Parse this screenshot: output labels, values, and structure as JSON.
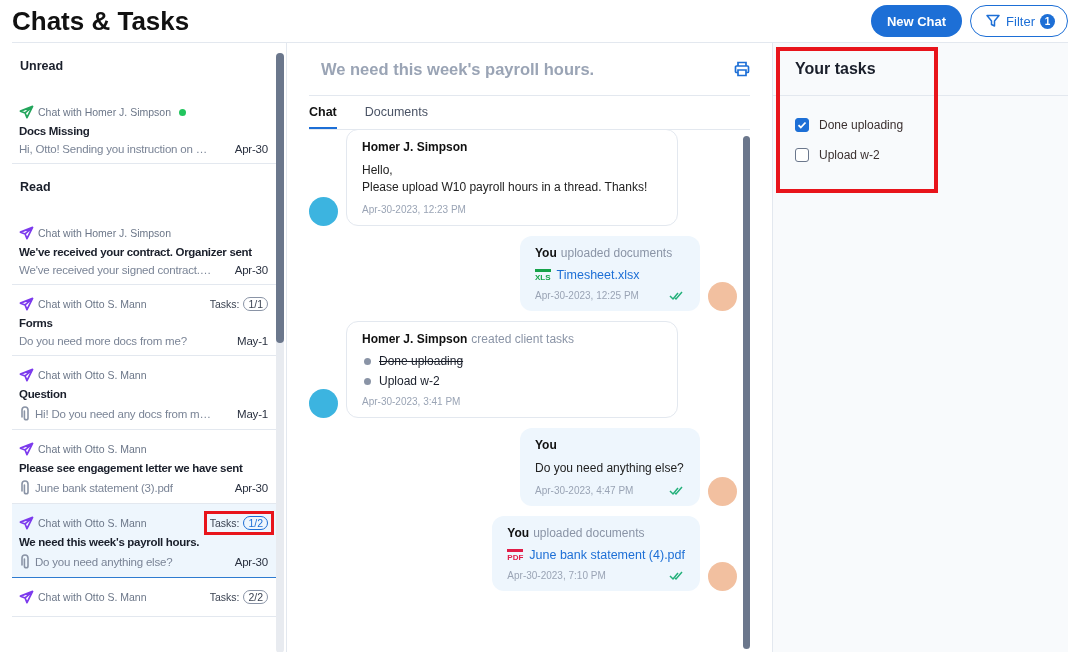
{
  "header": {
    "title": "Chats & Tasks",
    "new_chat": "New Chat",
    "filter": {
      "label": "Filter",
      "count": "1"
    }
  },
  "sidebar": {
    "sections": [
      {
        "heading": "Unread",
        "items": [
          {
            "chat_with": "Chat with Homer J. Simpson",
            "color": "#22a55b",
            "online": true,
            "title": "Docs Missing",
            "preview": "Hi, Otto! Sending you instruction on …",
            "attachment": false,
            "date": "Apr-30",
            "selected": false
          }
        ]
      },
      {
        "heading": "Read",
        "items": [
          {
            "chat_with": "Chat with Homer J. Simpson",
            "color": "#7c3aed",
            "online": false,
            "title": "We've received your contract. Organizer sent",
            "preview": "We've received your signed contract.…",
            "attachment": false,
            "date": "Apr-30",
            "selected": false
          },
          {
            "chat_with": "Chat with Otto S. Mann",
            "color": "#7c3aed",
            "online": false,
            "tasks": {
              "label": "Tasks:",
              "count": "1/1",
              "highlighted": false
            },
            "title": "Forms",
            "preview": "Do you need more docs from me?",
            "attachment": false,
            "date": "May-1",
            "selected": false
          },
          {
            "chat_with": "Chat with Otto S. Mann",
            "color": "#7c3aed",
            "online": false,
            "title": "Question",
            "preview": "Hi! Do you need any docs from m…",
            "attachment": true,
            "date": "May-1",
            "selected": false
          },
          {
            "chat_with": "Chat with Otto S. Mann",
            "color": "#7c3aed",
            "online": false,
            "title": "Please see engagement letter we have sent",
            "preview": "June bank statement (3).pdf",
            "attachment": true,
            "date": "Apr-30",
            "selected": false
          },
          {
            "chat_with": "Chat with Otto S. Mann",
            "color": "#7c3aed",
            "online": false,
            "tasks": {
              "label": "Tasks:",
              "count": "1/2",
              "highlighted": true
            },
            "title": "We need this week's payroll hours.",
            "preview": "Do you need anything else?",
            "attachment": true,
            "date": "Apr-30",
            "selected": true
          },
          {
            "chat_with": "Chat with Otto S. Mann",
            "color": "#7c3aed",
            "online": false,
            "tasks": {
              "label": "Tasks:",
              "count": "2/2",
              "highlighted": false
            },
            "selected": false
          }
        ]
      }
    ]
  },
  "conversation": {
    "title": "We need this week's payroll hours.",
    "tabs": [
      {
        "label": "Chat",
        "selected": true
      },
      {
        "label": "Documents",
        "selected": false
      }
    ],
    "messages": [
      {
        "kind": "text",
        "outgoing": false,
        "author": "Homer J. Simpson",
        "lines": [
          "Hello,",
          "Please upload W10 payroll hours in a thread. Thanks!"
        ],
        "time": "Apr-30-2023, 12:23 PM"
      },
      {
        "kind": "upload",
        "outgoing": true,
        "author": "You",
        "action": "uploaded documents",
        "file": {
          "name": "Timesheet.xlsx",
          "kind": "xls",
          "badge": "XLS"
        },
        "time": "Apr-30-2023, 12:25 PM",
        "read": true
      },
      {
        "kind": "tasks",
        "outgoing": false,
        "author": "Homer J. Simpson",
        "action": "created client tasks",
        "tasks": [
          {
            "label": "Done uploading",
            "done": true
          },
          {
            "label": "Upload w-2",
            "done": false
          }
        ],
        "time": "Apr-30-2023, 3:41 PM"
      },
      {
        "kind": "text",
        "outgoing": true,
        "author": "You",
        "lines": [
          "Do you need anything else?"
        ],
        "time": "Apr-30-2023, 4:47 PM",
        "read": true
      },
      {
        "kind": "upload",
        "outgoing": true,
        "author": "You",
        "action": "uploaded documents",
        "file": {
          "name": "June bank statement (4).pdf",
          "kind": "pdf",
          "badge": "PDF"
        },
        "time": "Apr-30-2023, 7:10 PM",
        "read": true
      }
    ]
  },
  "tasks_panel": {
    "title": "Your tasks",
    "highlighted": true,
    "tasks": [
      {
        "label": "Done uploading",
        "checked": true
      },
      {
        "label": "Upload w-2",
        "checked": false
      }
    ]
  }
}
